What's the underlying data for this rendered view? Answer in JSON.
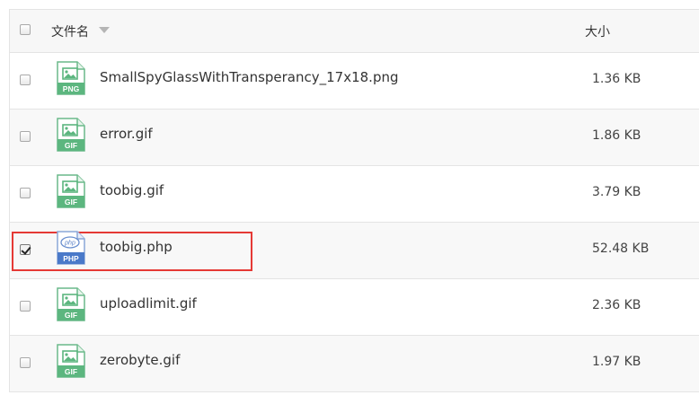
{
  "header": {
    "name_label": "文件名",
    "size_label": "大小"
  },
  "colors": {
    "image_icon": "#5cb67f",
    "php_icon": "#4a79c9",
    "highlight": "#e53935"
  },
  "files": [
    {
      "name": "SmallSpyGlassWithTransperancy_17x18.png",
      "size": "1.36 KB",
      "type_badge": "PNG",
      "icon": "image-file-icon",
      "checked": false
    },
    {
      "name": "error.gif",
      "size": "1.86 KB",
      "type_badge": "GIF",
      "icon": "image-file-icon",
      "checked": false
    },
    {
      "name": "toobig.gif",
      "size": "3.79 KB",
      "type_badge": "GIF",
      "icon": "image-file-icon",
      "checked": false
    },
    {
      "name": "toobig.php",
      "size": "52.48 KB",
      "type_badge": "PHP",
      "icon": "php-file-icon",
      "php_glyph": "php",
      "checked": true
    },
    {
      "name": "uploadlimit.gif",
      "size": "2.36 KB",
      "type_badge": "GIF",
      "icon": "image-file-icon",
      "checked": false
    },
    {
      "name": "zerobyte.gif",
      "size": "1.97 KB",
      "type_badge": "GIF",
      "icon": "image-file-icon",
      "checked": false
    }
  ]
}
